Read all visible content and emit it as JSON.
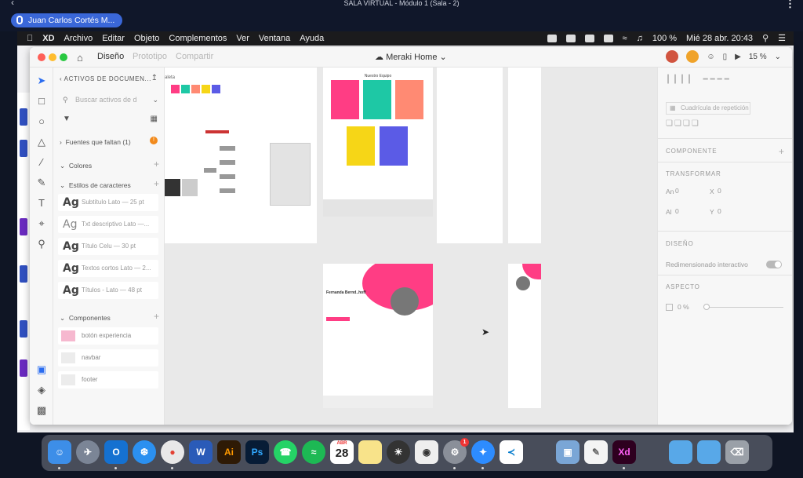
{
  "call": {
    "title": "SALA VIRTUAL - Módulo 1 (Sala - 2)",
    "speaker": "Juan Carlos Cortés M..."
  },
  "menubar": {
    "app": "XD",
    "items": [
      "Archivo",
      "Editar",
      "Objeto",
      "Complementos",
      "Ver",
      "Ventana",
      "Ayuda"
    ],
    "battery": "100 %",
    "datetime": "Mié 28 abr.  20:43"
  },
  "window": {
    "tabs": [
      "Diseño",
      "Prototipo",
      "Compartir"
    ],
    "doc_title": "Meraki Home",
    "zoom": "15 %"
  },
  "assets": {
    "header": "ACTIVOS DE DOCUMEN...",
    "search_placeholder": "Buscar activos de d",
    "missing_fonts": "Fuentes que faltan (1)",
    "colors_label": "Colores",
    "char_styles_label": "Estilos de caracteres",
    "char_styles": [
      {
        "ag": "Ag",
        "label": "Subtítulo Lato — 25 pt"
      },
      {
        "ag": "Ag",
        "label": "Txt descriptivo Lato —..."
      },
      {
        "ag": "Ag",
        "label": "Título Celu — 30 pt"
      },
      {
        "ag": "Ag",
        "label": "Textos cortos Lato — 2..."
      },
      {
        "ag": "Ag",
        "label": "Títulos - Lato — 48 pt"
      }
    ],
    "components_label": "Componentes",
    "components": [
      "botón experiencia",
      "navbar",
      "footer"
    ]
  },
  "canvas": {
    "palette_label": "aleta",
    "palette_colors": [
      "#ff3d84",
      "#1ec8a5",
      "#ff8a73",
      "#f6d617",
      "#5b5be6"
    ],
    "team_title": "Nuestro Equipo",
    "profile_name": "Fernanda Bernd..hoff"
  },
  "props": {
    "repeat_grid": "Cuadrícula de repetición",
    "component": "COMPONENTE",
    "transform": "TRANSFORMAR",
    "w_label": "An",
    "w_value": "0",
    "x_label": "X",
    "x_value": "0",
    "h_label": "Al",
    "h_value": "0",
    "y_label": "Y",
    "y_value": "0",
    "design": "DISEÑO",
    "responsive": "Redimensionado interactivo",
    "appearance": "ASPECTO",
    "opacity": "0 %"
  },
  "dock": {
    "apps": [
      "Finder",
      "Launchpad",
      "Outlook",
      "Safari",
      "Chrome",
      "Word",
      "Illustrator",
      "Photoshop",
      "WhatsApp",
      "Spotify",
      "Calendar",
      "Notes",
      "Pixelmator",
      "Screenshot",
      "System Preferences",
      "Zoom",
      "VS Code",
      "Preview",
      "TextEdit",
      "Adobe XD",
      "Folder",
      "Folder",
      "Trash"
    ],
    "calendar_month": "ABR",
    "calendar_day": "28",
    "badge": "1"
  }
}
